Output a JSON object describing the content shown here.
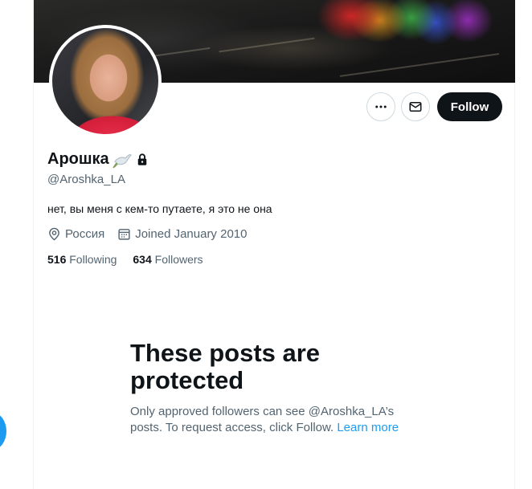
{
  "profile": {
    "display_name": "Арошка",
    "handle": "@Aroshka_LA",
    "bio": "нет, вы меня с кем-то путаете, я это не она",
    "location": "Россия",
    "joined": "Joined January 2010",
    "following_count": "516",
    "following_label": "Following",
    "followers_count": "634",
    "followers_label": "Followers"
  },
  "actions": {
    "more_icon": "more-dots-icon",
    "message_icon": "envelope-icon",
    "follow_label": "Follow"
  },
  "protected_notice": {
    "title": "These posts are protected",
    "body": "Only approved followers can see @Aroshka_LA’s posts. To request access, click Follow.",
    "learn_more": "Learn more"
  },
  "colors": {
    "accent": "#1d9bf0",
    "primary_button": "#0f1419",
    "secondary_text": "#536471"
  }
}
